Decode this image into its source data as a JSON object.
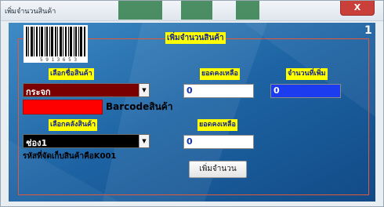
{
  "window": {
    "title": "เพิ่มจำนวนสินค้า",
    "close_icon": "close-icon",
    "close_glyph": "X"
  },
  "header": {
    "title": "เพิ่มจำนวนสินค้า",
    "page_number": "1"
  },
  "barcode": {
    "digits": "5 9 1 3 6 5 3"
  },
  "product": {
    "label": "เลือกชื่อสินค้า",
    "value": "กระจก",
    "barcode_label": "Barcodeสินค้า"
  },
  "stock_balance": {
    "label": "ยอดคงเหลือ",
    "value": "0"
  },
  "add_quantity": {
    "label": "จำนวนที่เพิ่ม",
    "value": "0"
  },
  "warehouse": {
    "label": "เลือกคลังสินค้า",
    "value": "ช่อง1",
    "code_text": "รหัสที่จัดเก็บสินค้าคือK001"
  },
  "warehouse_balance": {
    "label": "ยอดคงเหลือ",
    "value": "0"
  },
  "actions": {
    "add_button": "เพิ่มจำนวน"
  },
  "colors": {
    "label_bg": "#ffff00",
    "label_text": "#1a2a8a",
    "product_combo": "#7a0000",
    "warehouse_combo": "#000000",
    "qty_field": "#1c3cf0",
    "barcode_block": "#ff0000",
    "frame": "#e05a3a"
  }
}
